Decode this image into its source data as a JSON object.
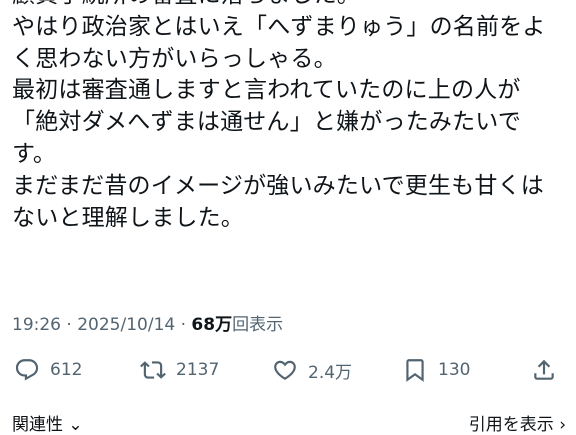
{
  "post": {
    "lines": [
      "顧資手続所の審査に落ちました。",
      "やはり政治家とはいえ「へずまりゅう」の名前をよ",
      "く思わない方がいらっしゃる。",
      "最初は審査通しますと言われていたのに上の人が",
      "「絶対ダメへずまは通せん」と嫌がったみたいで",
      "す。",
      "まだまだ昔のイメージが強いみたいで更生も甘くは",
      "ないと理解しました。"
    ],
    "time": "19:26",
    "separator": "·",
    "date": "2025/10/14",
    "views_count": "68万",
    "views_label": "回表示"
  },
  "actions": {
    "replies": "612",
    "reposts": "2137",
    "likes": "2.4万",
    "bookmarks": "130"
  },
  "footer": {
    "related": "関連性 ⌄",
    "view_quotes": "引用を表示 ›"
  },
  "icons": {
    "reply": "reply-icon",
    "repost": "repost-icon",
    "like": "heart-icon",
    "bookmark": "bookmark-icon",
    "share": "share-icon"
  },
  "colors": {
    "text": "#0f1419",
    "muted": "#536471",
    "background": "#ffffff"
  }
}
